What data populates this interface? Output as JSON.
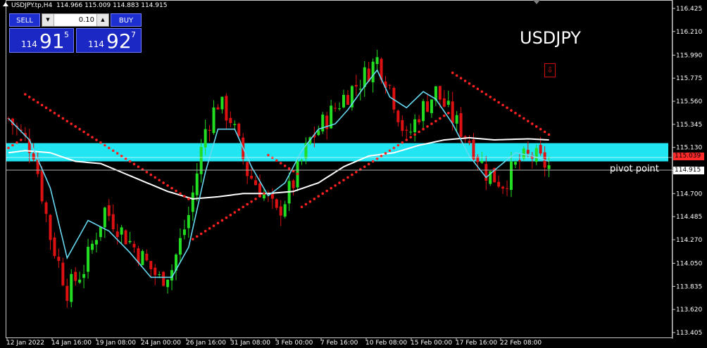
{
  "header": {
    "symbol_info": "USDJPY.tp,H4",
    "ohlc": "114.966 115.009 114.883 114.915"
  },
  "trade_panel": {
    "sell_label": "SELL",
    "buy_label": "BUY",
    "lot_value": "0.10",
    "dec_glyph": "▼",
    "inc_glyph": "▲",
    "sell_prefix": "114",
    "sell_big": "91",
    "sell_sup": "5",
    "buy_prefix": "114",
    "buy_big": "92",
    "buy_sup": "7"
  },
  "symbol_label": "USDJPY",
  "arrow_glyph": "⇩",
  "pivot_label": "pivot point",
  "price_tags": {
    "red": "115.039",
    "white": "114.915"
  },
  "colors": {
    "bull": "#22dd22",
    "bear": "#dd1111",
    "sar": "#ff2020",
    "ma_fast": "#66d8f0",
    "ma_slow": "#ffffff",
    "pivot_band": "#21e6f2"
  },
  "chart_data": {
    "type": "candlestick",
    "title": "USDJPY",
    "timeframe": "H4",
    "ylim": [
      113.4,
      116.5
    ],
    "y_ticks": [
      "116.425",
      "116.210",
      "115.990",
      "115.775",
      "115.560",
      "115.345",
      "115.130",
      "114.915",
      "114.700",
      "114.485",
      "114.270",
      "114.050",
      "113.835",
      "113.620",
      "113.405"
    ],
    "x_ticks": [
      "12 Jan 2022",
      "14 Jan 16:00",
      "19 Jan 08:00",
      "24 Jan 00:00",
      "26 Jan 16:00",
      "31 Jan 08:00",
      "3 Feb 00:00",
      "7 Feb 16:00",
      "10 Feb 08:00",
      "15 Feb 00:00",
      "17 Feb 16:00",
      "22 Feb 08:00"
    ],
    "current_bid": 114.915,
    "marked_price": 115.039,
    "pivot_zone": [
      115.0,
      115.17
    ],
    "close_path": [
      [
        0,
        115.4
      ],
      [
        6,
        115.1
      ],
      [
        10,
        114.3
      ],
      [
        14,
        113.8
      ],
      [
        18,
        114.0
      ],
      [
        23,
        114.55
      ],
      [
        27,
        114.35
      ],
      [
        32,
        114.1
      ],
      [
        36,
        113.9
      ],
      [
        39,
        114.0
      ],
      [
        43,
        114.5
      ],
      [
        47,
        115.3
      ],
      [
        50,
        115.55
      ],
      [
        53,
        115.4
      ],
      [
        57,
        114.9
      ],
      [
        61,
        114.7
      ],
      [
        64,
        114.5
      ],
      [
        68,
        114.8
      ],
      [
        72,
        115.2
      ],
      [
        76,
        115.4
      ],
      [
        80,
        115.6
      ],
      [
        84,
        115.75
      ],
      [
        88,
        115.95
      ],
      [
        91,
        115.7
      ],
      [
        95,
        115.2
      ],
      [
        98,
        115.45
      ],
      [
        102,
        115.65
      ],
      [
        106,
        115.4
      ],
      [
        110,
        115.2
      ],
      [
        114,
        114.9
      ],
      [
        118,
        114.8
      ],
      [
        122,
        115.0
      ],
      [
        125,
        115.05
      ],
      [
        129,
        114.95
      ]
    ],
    "ma_fast": [
      [
        0,
        115.4
      ],
      [
        5,
        115.2
      ],
      [
        10,
        114.75
      ],
      [
        14,
        114.1
      ],
      [
        19,
        114.45
      ],
      [
        24,
        114.35
      ],
      [
        29,
        114.15
      ],
      [
        34,
        113.92
      ],
      [
        39,
        113.92
      ],
      [
        43,
        114.2
      ],
      [
        47,
        114.9
      ],
      [
        50,
        115.3
      ],
      [
        54,
        115.3
      ],
      [
        58,
        114.95
      ],
      [
        62,
        114.68
      ],
      [
        66,
        114.8
      ],
      [
        70,
        115.1
      ],
      [
        74,
        115.3
      ],
      [
        78,
        115.35
      ],
      [
        81,
        115.48
      ],
      [
        85,
        115.7
      ],
      [
        88,
        115.85
      ],
      [
        91,
        115.6
      ],
      [
        95,
        115.5
      ],
      [
        99,
        115.65
      ],
      [
        102,
        115.58
      ],
      [
        106,
        115.35
      ],
      [
        110,
        115.05
      ],
      [
        114,
        114.85
      ],
      [
        117,
        114.95
      ],
      [
        121,
        115.08
      ],
      [
        125,
        115.05
      ],
      [
        129,
        115.0
      ]
    ],
    "ma_slow": [
      [
        0,
        115.08
      ],
      [
        4,
        115.1
      ],
      [
        10,
        115.08
      ],
      [
        16,
        115.0
      ],
      [
        22,
        114.98
      ],
      [
        30,
        114.85
      ],
      [
        38,
        114.72
      ],
      [
        44,
        114.65
      ],
      [
        50,
        114.67
      ],
      [
        56,
        114.7
      ],
      [
        62,
        114.7
      ],
      [
        68,
        114.72
      ],
      [
        74,
        114.8
      ],
      [
        80,
        114.95
      ],
      [
        86,
        115.05
      ],
      [
        92,
        115.08
      ],
      [
        98,
        115.15
      ],
      [
        104,
        115.2
      ],
      [
        110,
        115.22
      ],
      [
        116,
        115.2
      ],
      [
        124,
        115.21
      ],
      [
        129,
        115.2
      ]
    ]
  }
}
